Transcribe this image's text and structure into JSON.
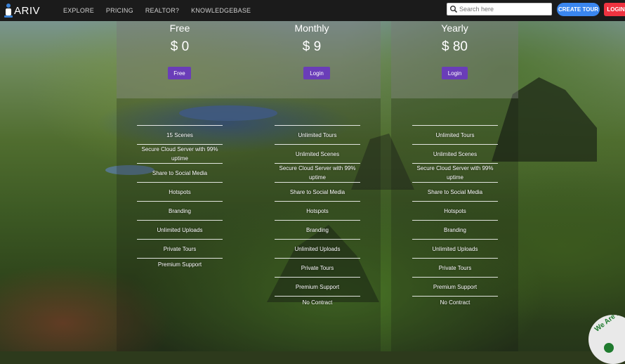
{
  "brand": {
    "logo_text": "ARIV"
  },
  "nav": {
    "links": [
      "EXPLORE",
      "PRICING",
      "REALTOR?",
      "KNOWLEDGEBASE"
    ],
    "search_placeholder": "Search here",
    "create_tour_label": "CREATE TOUR",
    "login_label": "LOGIN"
  },
  "colors": {
    "accent_blue": "#3a86ef",
    "login_red": "#ef3340",
    "plan_button_purple": "#6a3db8"
  },
  "plans": [
    {
      "name": "Free",
      "price": "$ 0",
      "button": "Free",
      "features": [
        "15 Scenes",
        "Secure Cloud Server with 99% uptime",
        "Share to Social Media",
        "Hotspots",
        "Branding",
        "Unlimited Uploads",
        "Private Tours",
        "Premium Support"
      ]
    },
    {
      "name": "Monthly",
      "price": "$ 9",
      "button": "Login",
      "features": [
        "Unlimited Tours",
        "Unlimited Scenes",
        "Secure Cloud Server with 99% uptime",
        "Share to Social Media",
        "Hotspots",
        "Branding",
        "Unlimited Uploads",
        "Private Tours",
        "Premium Support",
        "No Contract"
      ]
    },
    {
      "name": "Yearly",
      "price": "$ 80",
      "button": "Login",
      "features": [
        "Unlimited Tours",
        "Unlimited Scenes",
        "Secure Cloud Server with 99% uptime",
        "Share to Social Media",
        "Hotspots",
        "Branding",
        "Unlimited Uploads",
        "Private Tours",
        "Premium Support",
        "No Contract"
      ]
    }
  ],
  "badge": {
    "text": "We Are Here"
  }
}
